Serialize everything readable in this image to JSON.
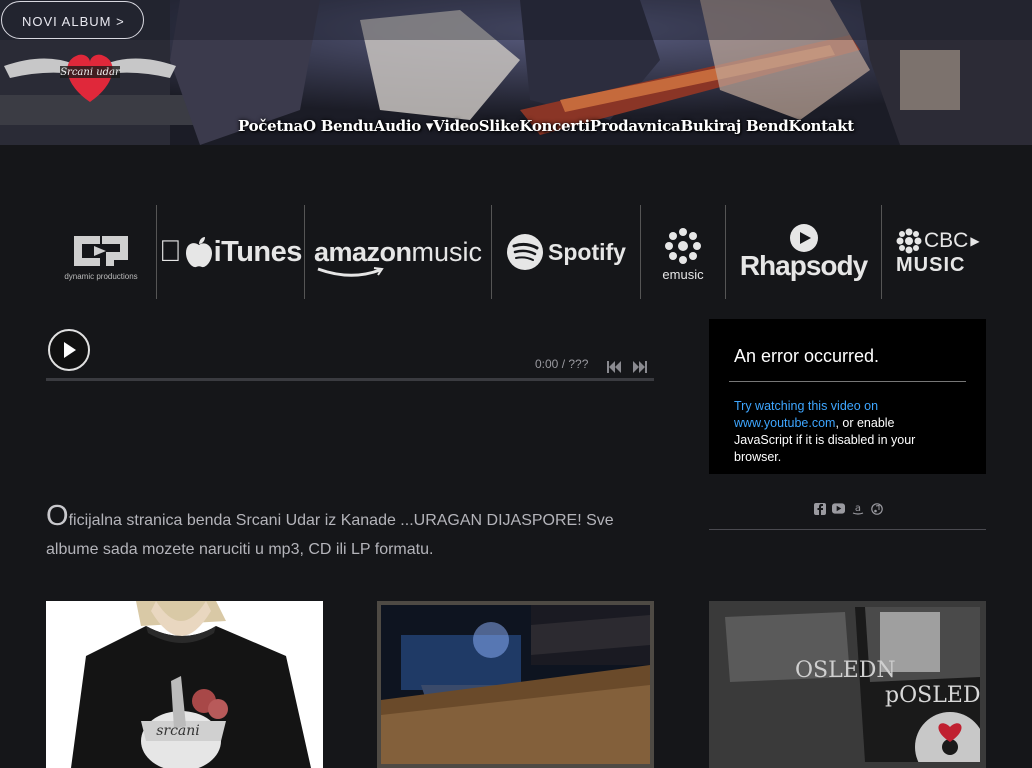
{
  "header": {
    "cta_label": "NOVI ALBUM >",
    "logo_text": "Srcani udar",
    "nav": [
      {
        "label": "Početna"
      },
      {
        "label": "O Bendu"
      },
      {
        "label": "Audio ▾"
      },
      {
        "label": "Video"
      },
      {
        "label": "Slike"
      },
      {
        "label": "Koncerti"
      },
      {
        "label": "Prodavnica"
      },
      {
        "label": "Bukiraj Bend"
      },
      {
        "label": "Kontakt"
      }
    ]
  },
  "stores": {
    "dynamic": "dynamic productions",
    "itunes": "iTunes",
    "amazon": "amazon",
    "amazon_music": "music",
    "spotify": "Spotify",
    "emusic": "emusic",
    "rhapsody": "Rhapsody",
    "cbc": "CBC",
    "cbc_music": "MUSIC"
  },
  "player": {
    "time": "0:00 / ???"
  },
  "video": {
    "error_title": "An error occurred.",
    "link_text": "Try watching this video on www.youtube.com",
    "rest_text": ", or enable JavaScript if it is disabled in your browser."
  },
  "intro": {
    "dropcap": "O",
    "text": "ficijalna stranica benda Srcani Udar iz Kanade ...URAGAN DIJASPORE!  Sve albume sada mozete naruciti u mp3, CD ili LP formatu."
  },
  "social_icons": [
    "facebook-icon",
    "youtube-icon",
    "amazon-icon",
    "music-icon"
  ],
  "colors": {
    "background": "#151619",
    "link": "#3ea6ff",
    "text": "#b4b4ba"
  }
}
